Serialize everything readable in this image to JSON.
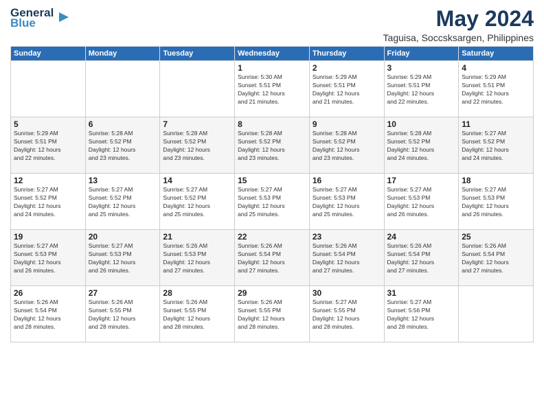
{
  "header": {
    "logo_line1": "General",
    "logo_line2": "Blue",
    "month_title": "May 2024",
    "location": "Taguisa, Soccsksargen, Philippines"
  },
  "days_of_week": [
    "Sunday",
    "Monday",
    "Tuesday",
    "Wednesday",
    "Thursday",
    "Friday",
    "Saturday"
  ],
  "weeks": [
    [
      {
        "day": "",
        "info": ""
      },
      {
        "day": "",
        "info": ""
      },
      {
        "day": "",
        "info": ""
      },
      {
        "day": "1",
        "info": "Sunrise: 5:30 AM\nSunset: 5:51 PM\nDaylight: 12 hours\nand 21 minutes."
      },
      {
        "day": "2",
        "info": "Sunrise: 5:29 AM\nSunset: 5:51 PM\nDaylight: 12 hours\nand 21 minutes."
      },
      {
        "day": "3",
        "info": "Sunrise: 5:29 AM\nSunset: 5:51 PM\nDaylight: 12 hours\nand 22 minutes."
      },
      {
        "day": "4",
        "info": "Sunrise: 5:29 AM\nSunset: 5:51 PM\nDaylight: 12 hours\nand 22 minutes."
      }
    ],
    [
      {
        "day": "5",
        "info": "Sunrise: 5:29 AM\nSunset: 5:51 PM\nDaylight: 12 hours\nand 22 minutes."
      },
      {
        "day": "6",
        "info": "Sunrise: 5:28 AM\nSunset: 5:52 PM\nDaylight: 12 hours\nand 23 minutes."
      },
      {
        "day": "7",
        "info": "Sunrise: 5:28 AM\nSunset: 5:52 PM\nDaylight: 12 hours\nand 23 minutes."
      },
      {
        "day": "8",
        "info": "Sunrise: 5:28 AM\nSunset: 5:52 PM\nDaylight: 12 hours\nand 23 minutes."
      },
      {
        "day": "9",
        "info": "Sunrise: 5:28 AM\nSunset: 5:52 PM\nDaylight: 12 hours\nand 23 minutes."
      },
      {
        "day": "10",
        "info": "Sunrise: 5:28 AM\nSunset: 5:52 PM\nDaylight: 12 hours\nand 24 minutes."
      },
      {
        "day": "11",
        "info": "Sunrise: 5:27 AM\nSunset: 5:52 PM\nDaylight: 12 hours\nand 24 minutes."
      }
    ],
    [
      {
        "day": "12",
        "info": "Sunrise: 5:27 AM\nSunset: 5:52 PM\nDaylight: 12 hours\nand 24 minutes."
      },
      {
        "day": "13",
        "info": "Sunrise: 5:27 AM\nSunset: 5:52 PM\nDaylight: 12 hours\nand 25 minutes."
      },
      {
        "day": "14",
        "info": "Sunrise: 5:27 AM\nSunset: 5:52 PM\nDaylight: 12 hours\nand 25 minutes."
      },
      {
        "day": "15",
        "info": "Sunrise: 5:27 AM\nSunset: 5:53 PM\nDaylight: 12 hours\nand 25 minutes."
      },
      {
        "day": "16",
        "info": "Sunrise: 5:27 AM\nSunset: 5:53 PM\nDaylight: 12 hours\nand 25 minutes."
      },
      {
        "day": "17",
        "info": "Sunrise: 5:27 AM\nSunset: 5:53 PM\nDaylight: 12 hours\nand 26 minutes."
      },
      {
        "day": "18",
        "info": "Sunrise: 5:27 AM\nSunset: 5:53 PM\nDaylight: 12 hours\nand 26 minutes."
      }
    ],
    [
      {
        "day": "19",
        "info": "Sunrise: 5:27 AM\nSunset: 5:53 PM\nDaylight: 12 hours\nand 26 minutes."
      },
      {
        "day": "20",
        "info": "Sunrise: 5:27 AM\nSunset: 5:53 PM\nDaylight: 12 hours\nand 26 minutes."
      },
      {
        "day": "21",
        "info": "Sunrise: 5:26 AM\nSunset: 5:53 PM\nDaylight: 12 hours\nand 27 minutes."
      },
      {
        "day": "22",
        "info": "Sunrise: 5:26 AM\nSunset: 5:54 PM\nDaylight: 12 hours\nand 27 minutes."
      },
      {
        "day": "23",
        "info": "Sunrise: 5:26 AM\nSunset: 5:54 PM\nDaylight: 12 hours\nand 27 minutes."
      },
      {
        "day": "24",
        "info": "Sunrise: 5:26 AM\nSunset: 5:54 PM\nDaylight: 12 hours\nand 27 minutes."
      },
      {
        "day": "25",
        "info": "Sunrise: 5:26 AM\nSunset: 5:54 PM\nDaylight: 12 hours\nand 27 minutes."
      }
    ],
    [
      {
        "day": "26",
        "info": "Sunrise: 5:26 AM\nSunset: 5:54 PM\nDaylight: 12 hours\nand 28 minutes."
      },
      {
        "day": "27",
        "info": "Sunrise: 5:26 AM\nSunset: 5:55 PM\nDaylight: 12 hours\nand 28 minutes."
      },
      {
        "day": "28",
        "info": "Sunrise: 5:26 AM\nSunset: 5:55 PM\nDaylight: 12 hours\nand 28 minutes."
      },
      {
        "day": "29",
        "info": "Sunrise: 5:26 AM\nSunset: 5:55 PM\nDaylight: 12 hours\nand 28 minutes."
      },
      {
        "day": "30",
        "info": "Sunrise: 5:27 AM\nSunset: 5:55 PM\nDaylight: 12 hours\nand 28 minutes."
      },
      {
        "day": "31",
        "info": "Sunrise: 5:27 AM\nSunset: 5:56 PM\nDaylight: 12 hours\nand 28 minutes."
      },
      {
        "day": "",
        "info": ""
      }
    ]
  ]
}
